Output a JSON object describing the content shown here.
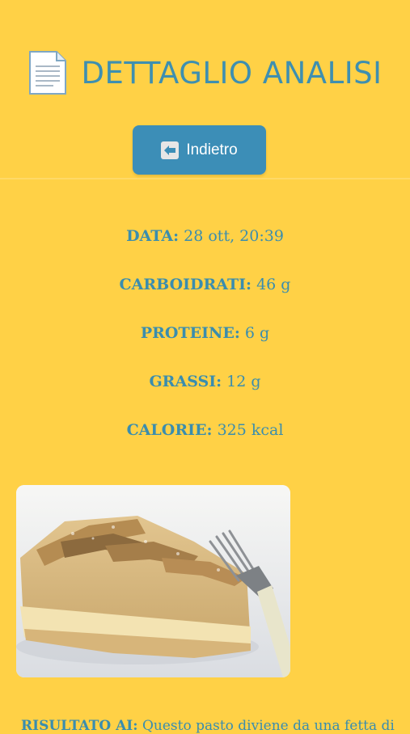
{
  "header": {
    "title": "DETTAGLIO ANALISI",
    "icon": "document-icon"
  },
  "back_button": {
    "label": "Indietro",
    "icon": "left-arrow-icon"
  },
  "stats": [
    {
      "label": "DATA:",
      "value": "28 ott, 20:39"
    },
    {
      "label": "CARBOIDRATI:",
      "value": "46 g"
    },
    {
      "label": "PROTEINE:",
      "value": "6 g"
    },
    {
      "label": "GRASSI:",
      "value": "12 g"
    },
    {
      "label": "CALORIE:",
      "value": "325 kcal"
    }
  ],
  "result": {
    "label": "RISULTATO AI:",
    "text": "Questo pasto diviene da una fetta di"
  },
  "colors": {
    "background": "#FFD146",
    "accent": "#3C8EB7",
    "text": "#3A8DAE"
  }
}
